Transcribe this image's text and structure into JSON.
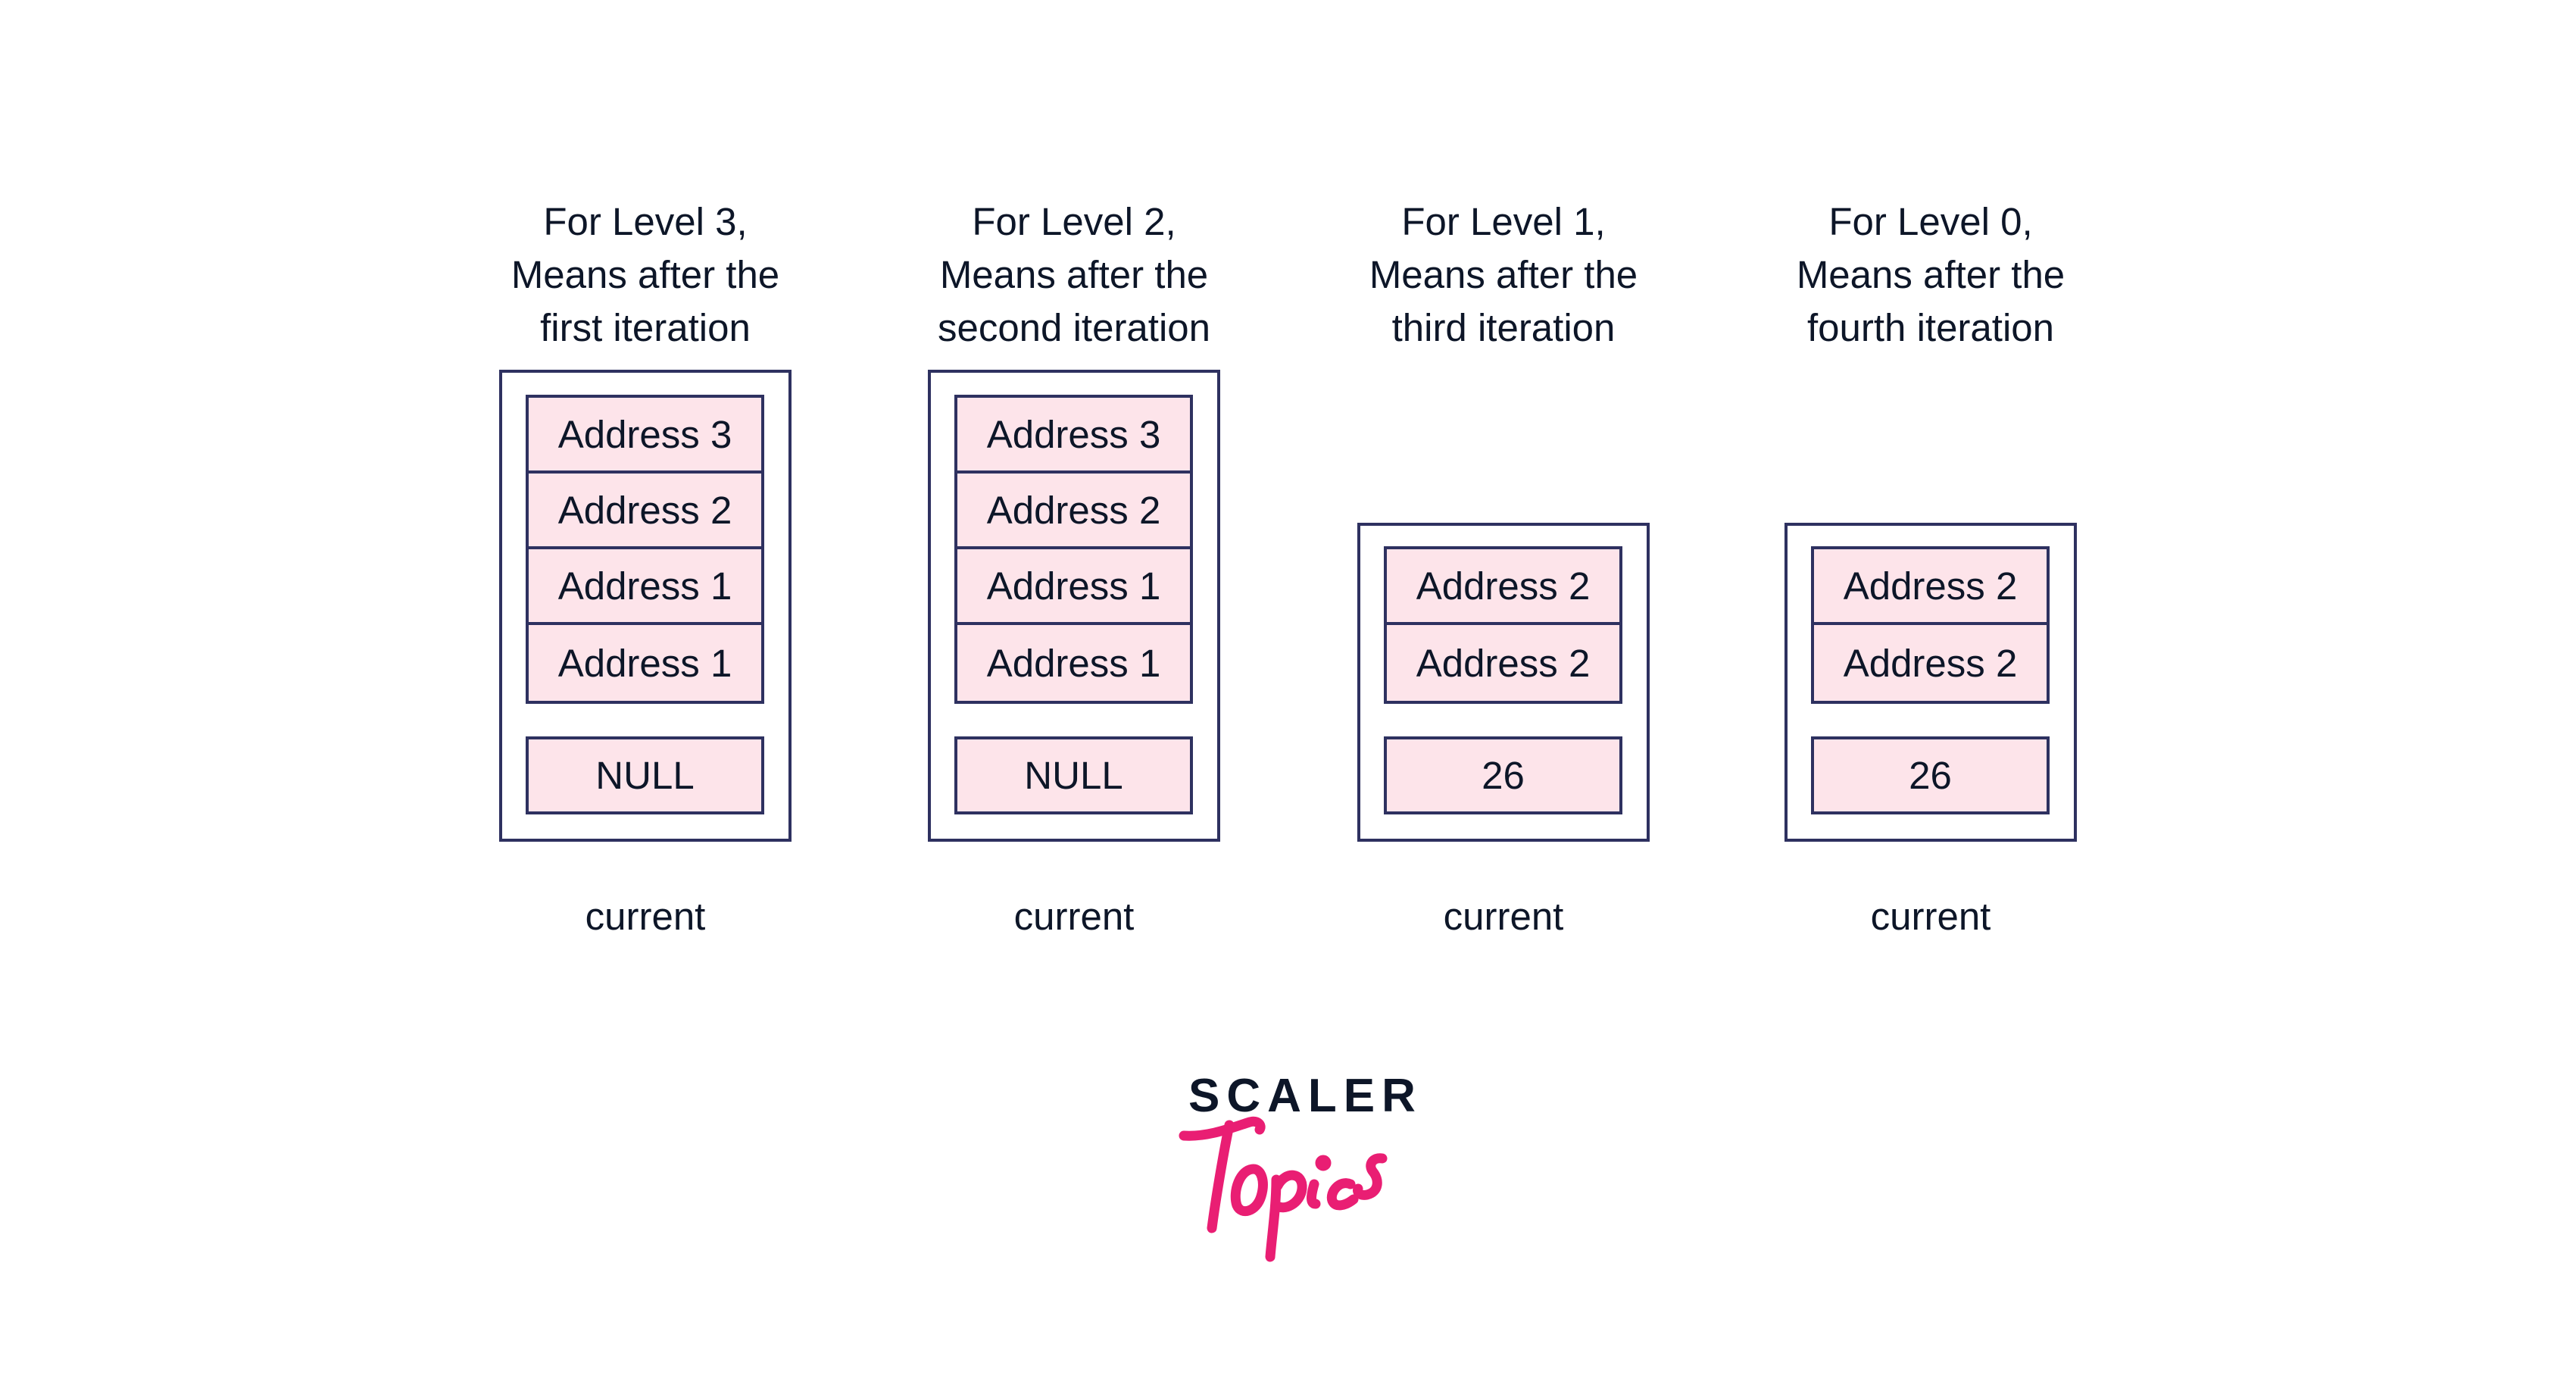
{
  "colors": {
    "border": "#2e3160",
    "cell_fill": "#fde4ea",
    "text": "#0d1628",
    "brand_pink": "#e91e73"
  },
  "columns": [
    {
      "heading": [
        "For Level 3,",
        "Means after the",
        "first iteration"
      ],
      "addresses": [
        "Address 3",
        "Address 2",
        "Address 1",
        "Address 1"
      ],
      "value": "NULL",
      "pointer_label": "current"
    },
    {
      "heading": [
        "For Level 2,",
        "Means after the",
        "second iteration"
      ],
      "addresses": [
        "Address 3",
        "Address 2",
        "Address 1",
        "Address 1"
      ],
      "value": "NULL",
      "pointer_label": "current"
    },
    {
      "heading": [
        "For Level 1,",
        "Means after the",
        "third iteration"
      ],
      "addresses": [
        "Address 2",
        "Address 2"
      ],
      "value": "26",
      "pointer_label": "current"
    },
    {
      "heading": [
        "For Level 0,",
        "Means after the",
        "fourth iteration"
      ],
      "addresses": [
        "Address 2",
        "Address 2"
      ],
      "value": "26",
      "pointer_label": "current"
    }
  ],
  "logo": {
    "wordmark_top": "SCALER",
    "wordmark_script": "Topics"
  }
}
